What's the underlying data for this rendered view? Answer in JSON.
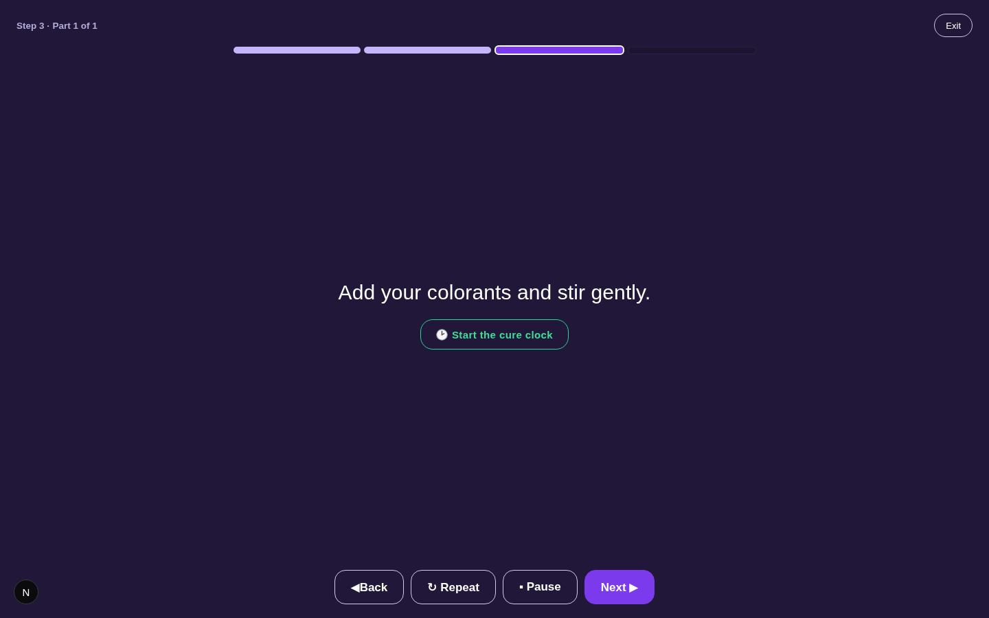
{
  "header": {
    "step_label": "Step 3 · Part 1 of 1",
    "exit_button": "Exit"
  },
  "progress": [
    {
      "kind": "done"
    },
    {
      "kind": "done"
    },
    {
      "kind": "current"
    },
    {
      "kind": "upcoming"
    }
  ],
  "instruction": "Add your colorants and stir gently.",
  "timer_button": {
    "label": "Start the cure clock"
  },
  "controls": [
    {
      "label": "◀Back",
      "kind": "outline"
    },
    {
      "label": "↻ Repeat",
      "kind": "outline"
    },
    {
      "label": "▪ Pause",
      "kind": "outline"
    },
    {
      "label": "Next ▶",
      "kind": "primary"
    }
  ],
  "dev_badge": "N"
}
